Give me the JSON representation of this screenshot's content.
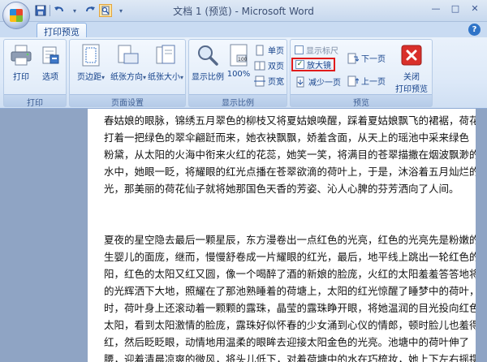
{
  "window": {
    "title": "文档 1 (预览) - Microsoft Word",
    "controls": [
      "—",
      "□",
      "✕"
    ]
  },
  "qat": [
    "save-icon",
    "undo-icon",
    "redo-icon",
    "print-preview-icon"
  ],
  "tabs": [
    {
      "label": "打印预览"
    }
  ],
  "ribbon": {
    "print_group": {
      "label": "打印",
      "print": "打印",
      "options": "选项"
    },
    "page_setup_group": {
      "label": "页面设置",
      "margins": "页边距",
      "orientation": "纸张方向",
      "size": "纸张大小"
    },
    "zoom_group": {
      "label": "显示比例",
      "zoom": "显示比例",
      "hundred": "100%",
      "one_page": "单页",
      "two_pages": "双页",
      "page_width": "页宽"
    },
    "preview_group": {
      "label": "预览",
      "show_ruler": "显示标尺",
      "show_ruler_checked": false,
      "magnifier": "放大镜",
      "magnifier_checked": true,
      "shrink_one_page": "减少一页",
      "next_page": "下一页",
      "prev_page": "上一页",
      "close_preview": "关闭\n打印预览",
      "close_line1": "关闭",
      "close_line2": "打印预览"
    }
  },
  "document": {
    "paragraph1": [
      "春姑娘的眼脉，锦绣五月翠色的柳枝又将夏姑娘唤醒，踩着夏姑娘飘飞的裙裾，荷花",
      "打着一把绿色的翠伞翩跹而来，她衣袂飘飘，娇羞含面，从天上的瑶池中采来绿色",
      "粉黛，从太阳的火海中衔来火红的花蕊，她笑一笑，将满目的苍翠描撒在烟波飘渺的",
      "水中，她眼一眨，将耀眼的红光点播在苍翠欲滴的荷叶上，于是，沐浴着五月灿烂的",
      "光，那美丽的荷花仙子就将她那国色天香的芳姿、沁人心脾的芬芳洒向了人间。"
    ],
    "paragraph2": [
      "夏夜的星空隐去最后一颗星辰，东方漫卷出一点红色的光亮，红色的光亮先是粉嫩的",
      "生婴儿的面庞，继而，慢慢舒卷成一片耀眼的红光，最后，地平线上跳出一轮红色的",
      "阳，红色的太阳又红又圆，像一个喝醉了酒的新娘的脸庞，火红的太阳羞羞答答地将",
      "的光辉洒下大地，照耀在了那池熟睡着的荷塘上，太阳的红光惊醒了睡梦中的荷叶，",
      "时，荷叶身上还滚动着一颗颗的露珠，晶莹的露珠睁开眼，将她温润的目光投向红色",
      "太阳，看到太阳激情的脸庞，露珠好似怀春的少女涌到心仪的情郎，顿时脸儿也羞得",
      "红，然后眨眨眼，动情地用温柔的眼眸去迎接太阳金色的光亮。池塘中的荷叶伸了",
      "腰，迎着清晨凉爽的微风，将头儿低下，对着荷塘中的水在巧梳妆，她上下左右摇摆"
    ]
  }
}
